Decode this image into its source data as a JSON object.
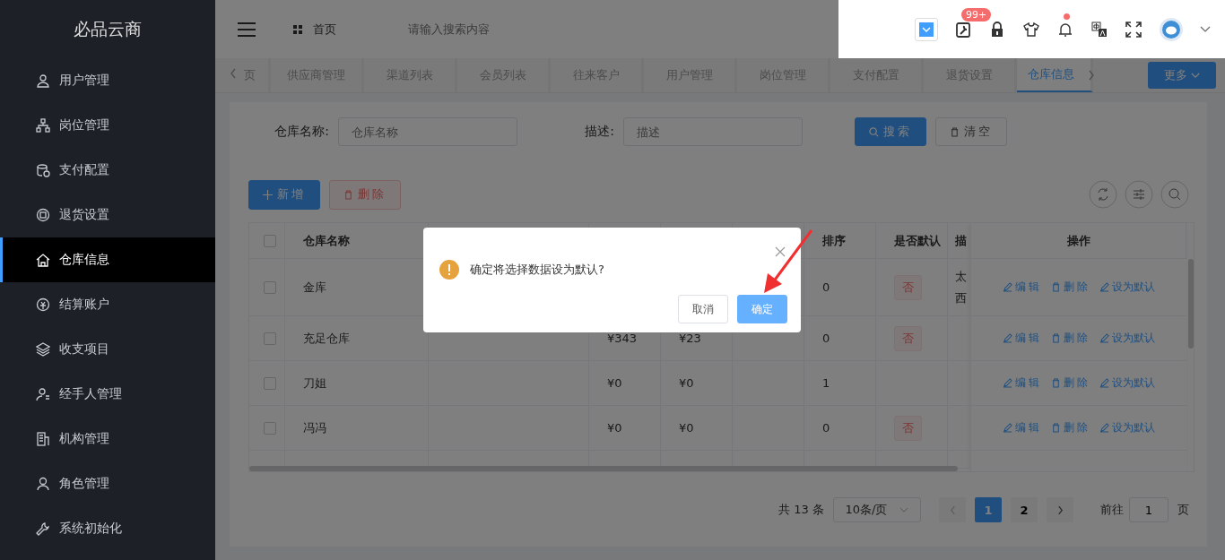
{
  "sidebar": {
    "logo": "必品云商",
    "items": [
      {
        "label": "用户管理",
        "selected": false
      },
      {
        "label": "岗位管理",
        "selected": false
      },
      {
        "label": "支付配置",
        "selected": false
      },
      {
        "label": "退货设置",
        "selected": false
      },
      {
        "label": "仓库信息",
        "selected": true
      },
      {
        "label": "结算账户",
        "selected": false
      },
      {
        "label": "收支项目",
        "selected": false
      },
      {
        "label": "经手人管理",
        "selected": false
      },
      {
        "label": "机构管理",
        "selected": false
      },
      {
        "label": "角色管理",
        "selected": false
      },
      {
        "label": "系统初始化",
        "selected": false
      }
    ]
  },
  "header": {
    "breadcrumb": "首页",
    "search": {
      "placeholder": "请输入搜索内容"
    },
    "badge": "99+",
    "bell_dot": true
  },
  "tabs": {
    "items": [
      {
        "label": "页",
        "selected": false
      },
      {
        "label": "供应商管理",
        "selected": false
      },
      {
        "label": "渠道列表",
        "selected": false
      },
      {
        "label": "会员列表",
        "selected": false
      },
      {
        "label": "往来客户",
        "selected": false
      },
      {
        "label": "用户管理",
        "selected": false
      },
      {
        "label": "岗位管理",
        "selected": false
      },
      {
        "label": "支付配置",
        "selected": false
      },
      {
        "label": "退货设置",
        "selected": false
      },
      {
        "label": "仓库信息",
        "selected": true
      }
    ],
    "more": "更多"
  },
  "filters": [
    {
      "label": "仓库名称:",
      "placeholder": "仓库名称"
    },
    {
      "label": "描述:",
      "placeholder": "描述"
    }
  ],
  "search_button": "搜索",
  "clear_button": "清空",
  "add_button": "新增",
  "delete_button": "删除",
  "table": {
    "select_all_checked": false,
    "columns": [
      "仓库名称",
      "排序",
      "是否默认",
      "描",
      "操作"
    ],
    "rows": [
      {
        "checked": false,
        "name": "金库",
        "sort": "0",
        "default": "否",
        "description": [
          "太",
          "西"
        ],
        "actions": [
          "编辑",
          "删除",
          "设为默认"
        ]
      },
      {
        "checked": false,
        "name": "充足仓库",
        "column_4": "¥343",
        "column_5": "¥23",
        "sort": "0",
        "default": "否",
        "actions": [
          "编辑",
          "删除",
          "设为默认"
        ]
      },
      {
        "checked": false,
        "name": "刀姐",
        "column_4": "¥0",
        "column_5": "¥0",
        "sort": "1",
        "actions": [
          "编辑",
          "删除",
          "设为默认"
        ]
      },
      {
        "checked": false,
        "name": "冯冯",
        "column_4": "¥0",
        "column_5": "¥0",
        "sort": "0",
        "default": "否",
        "actions": [
          "编辑",
          "删除",
          "设为默认"
        ]
      }
    ]
  },
  "pagination": {
    "total": "共 13 条",
    "page_size": "10条/页",
    "pages": [
      {
        "label": "1",
        "selected": true
      },
      {
        "label": "2",
        "selected": false
      }
    ],
    "goto_label": "前往",
    "goto_value": "1",
    "goto_suffix": "页"
  },
  "dialog": {
    "message": "确定将选择数据设为默认?",
    "cancel": "取消",
    "confirm": "确定"
  }
}
